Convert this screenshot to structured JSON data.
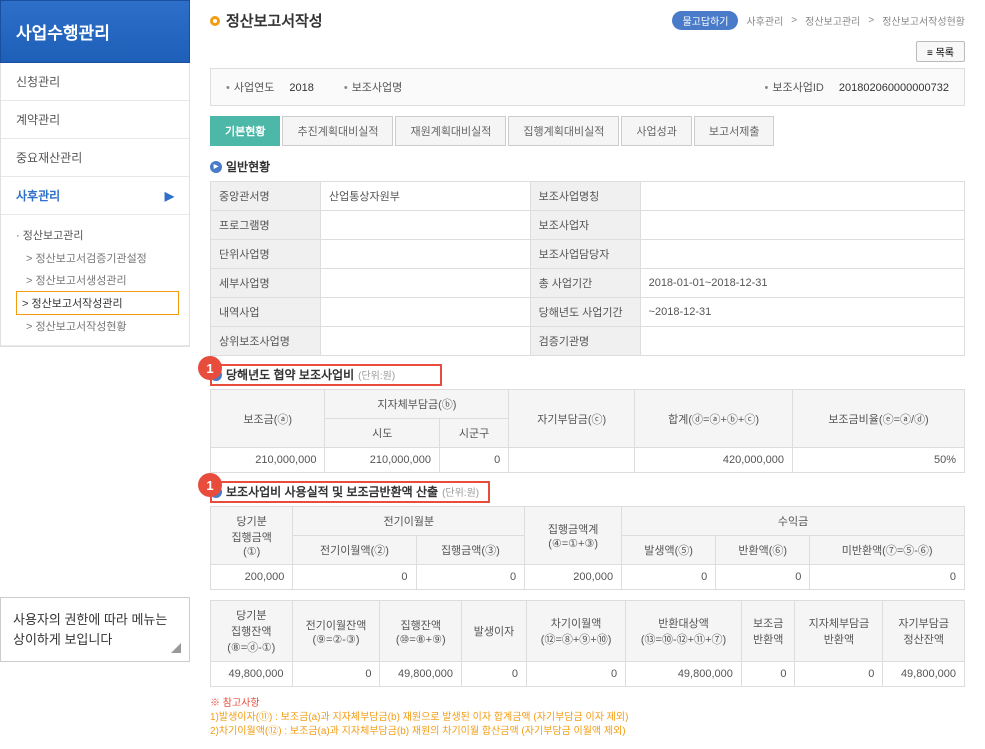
{
  "sidebar": {
    "title": "사업수행관리",
    "items": [
      {
        "label": "신청관리"
      },
      {
        "label": "계약관리"
      },
      {
        "label": "중요재산관리"
      },
      {
        "label": "사후관리",
        "active": true
      }
    ],
    "sub": {
      "title": "정산보고관리",
      "items": [
        {
          "label": "정산보고서검증기관설정"
        },
        {
          "label": "정산보고서생성관리"
        },
        {
          "label": "정산보고서작성관리",
          "selected": true
        },
        {
          "label": "정산보고서작성현황"
        }
      ]
    },
    "note": "사용자의 권한에 따라 메뉴는 상이하게 보입니다"
  },
  "header": {
    "title": "정산보고서작성",
    "help": "물고답하기",
    "breadcrumb": [
      "사후관리",
      "정산보고관리",
      "정산보고서작성현황"
    ],
    "list_btn": "목록"
  },
  "infobar": {
    "year_label": "사업연도",
    "year": "2018",
    "name_label": "보조사업명",
    "name": " ",
    "id_label": "보조사업ID",
    "id": "201802060000000732"
  },
  "tabs": [
    "기본현황",
    "추진계획대비실적",
    "재원계획대비실적",
    "집행계획대비실적",
    "사업성과",
    "보고서제출"
  ],
  "section1": {
    "title": "일반현황",
    "rows": [
      {
        "l1": "중앙관서명",
        "v1": "산업통상자원부",
        "l2": "보조사업명칭",
        "v2": " "
      },
      {
        "l1": "프로그램명",
        "v1": " ",
        "l2": "보조사업자",
        "v2": " "
      },
      {
        "l1": "단위사업명",
        "v1": " ",
        "l2": "보조사업담당자",
        "v2": " "
      },
      {
        "l1": "세부사업명",
        "v1": " ",
        "l2": "총 사업기간",
        "v2": "2018-01-01~2018-12-31"
      },
      {
        "l1": "내역사업",
        "v1": " ",
        "l2": "당해년도 사업기간",
        "v2": "           ~2018-12-31"
      },
      {
        "l1": "상위보조사업명",
        "v1": " ",
        "l2": "검증기관명",
        "v2": ""
      }
    ]
  },
  "section2": {
    "title": "당해년도 협약 보조사업비",
    "unit": "(단위:원)",
    "badge": "1",
    "headers": {
      "bojo": "보조금(ⓐ)",
      "jija": "지자체부담금(ⓑ)",
      "sido": "시도",
      "sigungu": "시군구",
      "jagi": "자기부담금(ⓒ)",
      "hap": "합계(ⓓ=ⓐ+ⓑ+ⓒ)",
      "biul": "보조금비율(ⓔ=ⓐ/ⓓ)"
    },
    "row": {
      "bojo": "210,000,000",
      "sido": "210,000,000",
      "sigungu": "0",
      "jagi": "",
      "hap": "420,000,000",
      "biul": "50%"
    }
  },
  "section3": {
    "title": "보조사업비 사용실적 및 보조금반환액 산출",
    "unit": "(단위:원)",
    "badge": "1",
    "headers1": {
      "danggi": "당기분\n집행금액\n(①)",
      "jeongi_group": "전기이월분",
      "jeongi_iwol": "전기이월액(②)",
      "jiphaeng": "집행금액(③)",
      "jiphaeng_gye": "집행금액계\n(④=①+③)",
      "suik": "수익금",
      "balsaeng": "발생액(⑤)",
      "banhwan": "반환액(⑥)",
      "miban": "미반환액(⑦=⑤-⑥)"
    },
    "row1": {
      "danggi": "200,000",
      "jeongi": "0",
      "jiphaeng": "0",
      "gye": "200,000",
      "balsaeng": "0",
      "banhwan": "0",
      "miban": "0"
    },
    "headers2": {
      "h1": "당기분\n집행잔액\n(⑧=ⓓ-①)",
      "h2": "전기이월잔액\n(⑨=②-③)",
      "h3": "집행잔액\n(⑩=⑧+⑨)",
      "h4": "발생이자",
      "h5": "차기이월액\n(⑫=⑧+⑨+⑩)",
      "h6": "반환대상액\n(⑬=⑩-⑫+⑪+⑦)",
      "h7": "보조금\n반환액",
      "h8": "지자체부담금\n반환액",
      "h9": "자기부담금\n정산잔액"
    },
    "row2": {
      "v1": "49,800,000",
      "v2": "0",
      "v3": "49,800,000",
      "v4": "0",
      "v5": "0",
      "v6": "49,800,000",
      "v7": "0",
      "v8": "0",
      "v9": "49,800,000"
    }
  },
  "footnote": {
    "title": "※ 참고사항",
    "line1": "1)발생이자(⑪) : 보조금(a)과 지자체부담금(b) 재원으로 발생된 이자 합계금액 (자기부담금 이자 제외)",
    "line2": "2)차기이월액(⑫) : 보조금(a)과 지자체부담금(b) 재원의 차기이월 합산금액 (자기부담금 이월액 제외)"
  }
}
